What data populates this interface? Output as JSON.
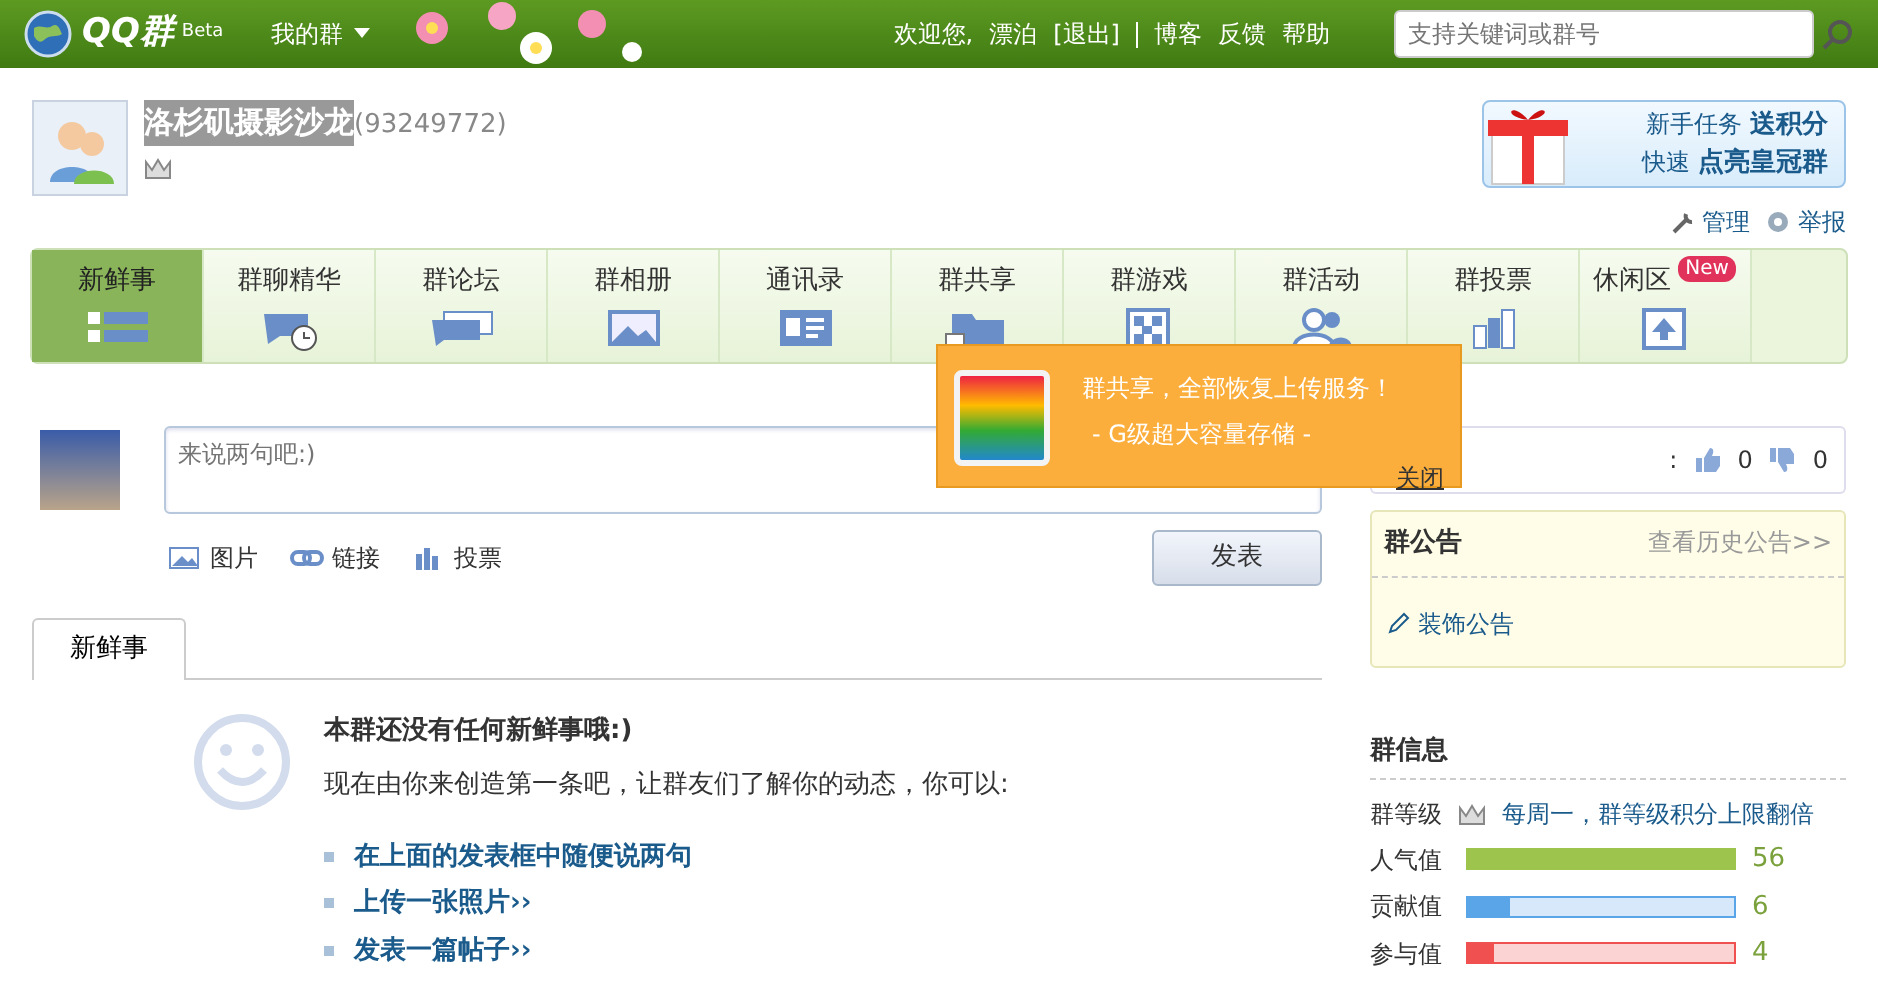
{
  "topbar": {
    "logo": "QQ群",
    "beta": "Beta",
    "my_groups": "我的群",
    "welcome": "欢迎您,",
    "user": "漂泊",
    "logout": "[退出]",
    "links": [
      "博客",
      "反馈",
      "帮助"
    ],
    "search": {
      "placeholder": "支持关键词或群号"
    }
  },
  "group": {
    "name": "洛杉矶摄影沙龙",
    "number": "(93249772)"
  },
  "promo": {
    "line1_prefix": "新手任务",
    "line1_link": "送积分",
    "line2_prefix": "快速",
    "line2_link": "点亮皇冠群"
  },
  "admin_links": [
    "管理",
    "举报"
  ],
  "tabs": [
    {
      "label": "新鲜事",
      "selected": true
    },
    {
      "label": "群聊精华",
      "selected": false
    },
    {
      "label": "群论坛",
      "selected": false
    },
    {
      "label": "群相册",
      "selected": false
    },
    {
      "label": "通讯录",
      "selected": false
    },
    {
      "label": "群共享",
      "selected": false
    },
    {
      "label": "群游戏",
      "selected": false
    },
    {
      "label": "群活动",
      "selected": false
    },
    {
      "label": "群投票",
      "selected": false
    },
    {
      "label": "休闲区",
      "selected": false,
      "badge": "New"
    }
  ],
  "popup": {
    "title": "群共享，全部恢复上传服务！",
    "subtitle": "- G级超大容量存储 -",
    "close": "关闭"
  },
  "composer": {
    "placeholder": "来说两句吧:)",
    "tools": [
      "图片",
      "链接",
      "投票"
    ],
    "submit": "发表"
  },
  "feed_tabs": [
    {
      "label": "新鲜事",
      "selected": true
    }
  ],
  "empty": {
    "title": "本群还没有任何新鲜事哦:)",
    "text": "现在由你来创造第一条吧，让群友们了解你的动态，你可以:",
    "actions": [
      "在上面的发表框中随便说两句",
      "上传一张照片››",
      "发表一篇帖子››"
    ]
  },
  "votes": {
    "colon": ":",
    "up": "0",
    "down": "0"
  },
  "notice": {
    "title": "群公告",
    "history": "查看历史公告>>",
    "decorate": "装饰公告"
  },
  "info": {
    "title": "群信息",
    "level_label": "群等级",
    "level_note": "每周一，群等级积分上限翻倍",
    "stats": [
      {
        "label": "人气值",
        "level": 1.0,
        "value": "56",
        "color": "#9dc44d"
      },
      {
        "label": "贡献值",
        "level": 0.16,
        "value": "6",
        "color": "#5aa5e8"
      },
      {
        "label": "参与值",
        "level": 0.1,
        "value": "4",
        "color": "#f05050"
      }
    ]
  }
}
